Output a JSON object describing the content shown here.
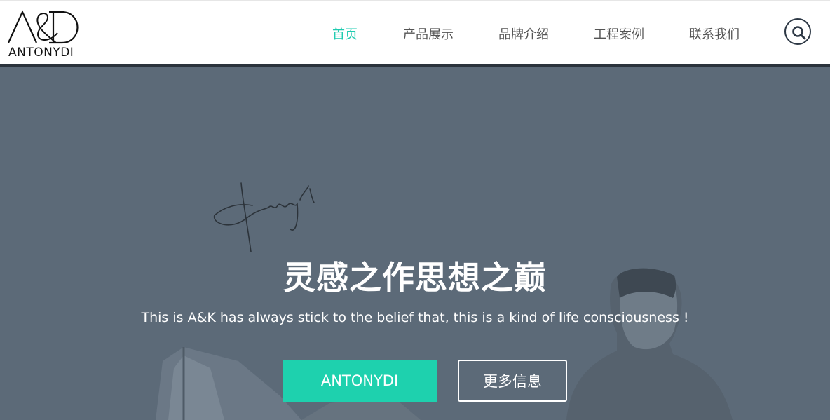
{
  "brand": {
    "logo_mark": "A&D",
    "name": "ANTONYDI"
  },
  "nav": {
    "items": [
      {
        "label": "首页",
        "active": true
      },
      {
        "label": "产品展示",
        "active": false
      },
      {
        "label": "品牌介绍",
        "active": false
      },
      {
        "label": "工程案例",
        "active": false
      },
      {
        "label": "联系我们",
        "active": false
      }
    ],
    "search_icon": "search-icon"
  },
  "hero": {
    "signature": "Antonydi",
    "title": "灵感之作思想之巅",
    "subtitle": "This is A&K has always stick to the belief that, this is a kind of life consciousness !",
    "primary_button": "ANTONYDI",
    "secondary_button": "更多信息"
  },
  "colors": {
    "accent": "#1ed1ae",
    "active_nav": "#1ecbb0",
    "hero_overlay": "#5c6a78",
    "header_bar": "#2b333c"
  }
}
